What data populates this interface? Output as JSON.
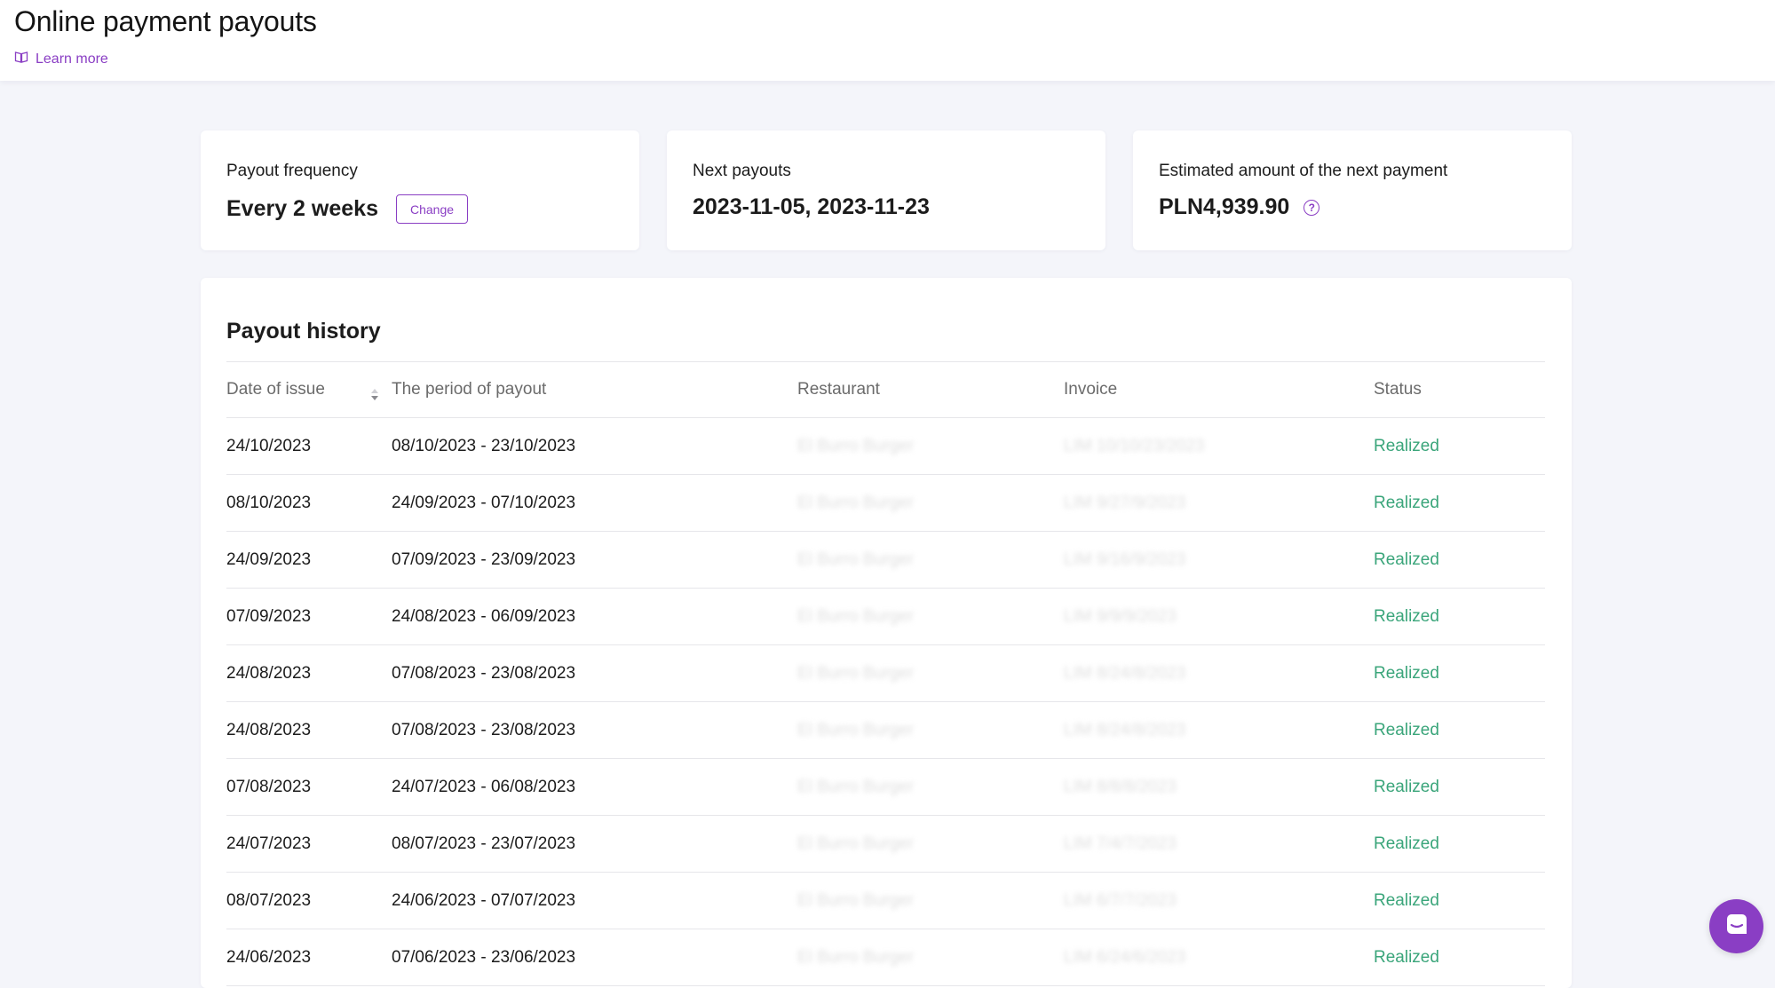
{
  "header": {
    "title": "Online payment payouts",
    "learn_more": "Learn more"
  },
  "cards": {
    "frequency": {
      "label": "Payout frequency",
      "value": "Every 2 weeks",
      "button": "Change"
    },
    "next": {
      "label": "Next payouts",
      "value": "2023-11-05, 2023-11-23"
    },
    "estimate": {
      "label": "Estimated amount of the next payment",
      "value": "PLN4,939.90"
    }
  },
  "history": {
    "title": "Payout history",
    "columns": {
      "date": "Date of issue",
      "period": "The period of payout",
      "restaurant": "Restaurant",
      "invoice": "Invoice",
      "status": "Status"
    },
    "rows": [
      {
        "date": "24/10/2023",
        "period": "08/10/2023 - 23/10/2023",
        "restaurant": "El Burro Burger",
        "invoice": "LIM 10/10/23/2023",
        "status": "Realized"
      },
      {
        "date": "08/10/2023",
        "period": "24/09/2023 - 07/10/2023",
        "restaurant": "El Burro Burger",
        "invoice": "LIM 9/27/9/2023",
        "status": "Realized"
      },
      {
        "date": "24/09/2023",
        "period": "07/09/2023 - 23/09/2023",
        "restaurant": "El Burro Burger",
        "invoice": "LIM 9/16/9/2023",
        "status": "Realized"
      },
      {
        "date": "07/09/2023",
        "period": "24/08/2023 - 06/09/2023",
        "restaurant": "El Burro Burger",
        "invoice": "LIM 9/9/9/2023",
        "status": "Realized"
      },
      {
        "date": "24/08/2023",
        "period": "07/08/2023 - 23/08/2023",
        "restaurant": "El Burro Burger",
        "invoice": "LIM 8/24/8/2023",
        "status": "Realized"
      },
      {
        "date": "24/08/2023",
        "period": "07/08/2023 - 23/08/2023",
        "restaurant": "El Burro Burger",
        "invoice": "LIM 8/24/8/2023",
        "status": "Realized"
      },
      {
        "date": "07/08/2023",
        "period": "24/07/2023 - 06/08/2023",
        "restaurant": "El Burro Burger",
        "invoice": "LIM 8/8/8/2023",
        "status": "Realized"
      },
      {
        "date": "24/07/2023",
        "period": "08/07/2023 - 23/07/2023",
        "restaurant": "El Burro Burger",
        "invoice": "LIM 7/4/7/2023",
        "status": "Realized"
      },
      {
        "date": "08/07/2023",
        "period": "24/06/2023 - 07/07/2023",
        "restaurant": "El Burro Burger",
        "invoice": "LIM 6/7/7/2023",
        "status": "Realized"
      },
      {
        "date": "24/06/2023",
        "period": "07/06/2023 - 23/06/2023",
        "restaurant": "El Burro Burger",
        "invoice": "LIM 6/24/6/2023",
        "status": "Realized"
      }
    ]
  },
  "colors": {
    "accent": "#8a3ec4",
    "status_realized": "#3aa57a",
    "background": "#f4f5fa"
  },
  "icons": {
    "learn_more": "book-icon",
    "estimate_help": "help-icon",
    "sort": "sort-icon",
    "chat": "chat-icon"
  }
}
